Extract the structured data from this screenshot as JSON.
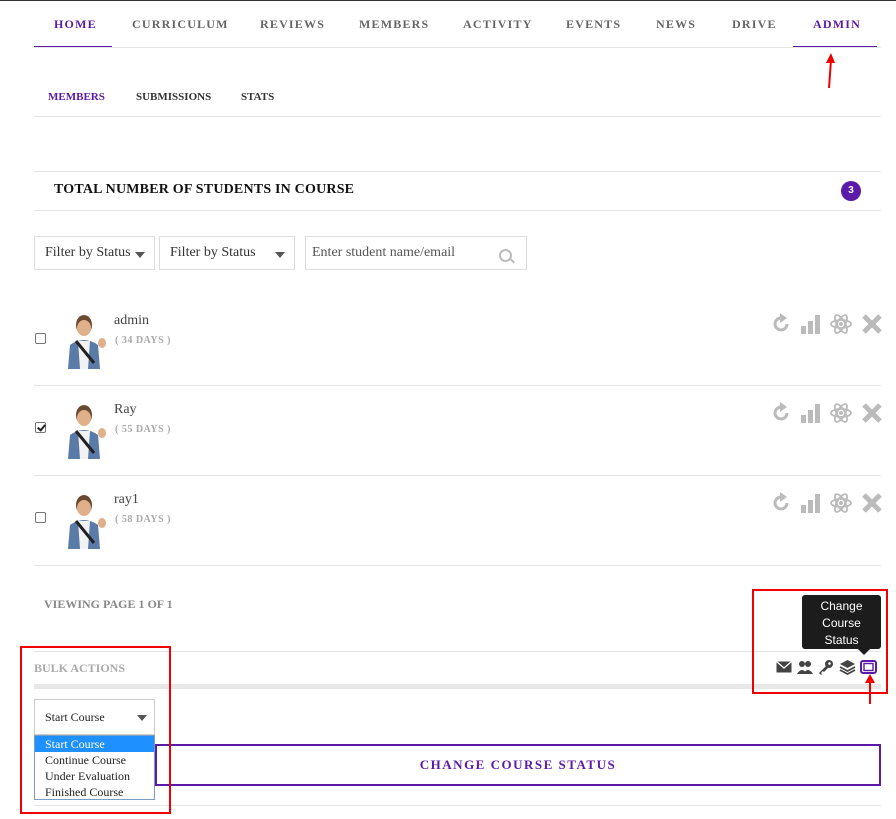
{
  "nav": {
    "items": [
      "HOME",
      "CURRICULUM",
      "REVIEWS",
      "MEMBERS",
      "ACTIVITY",
      "EVENTS",
      "NEWS",
      "DRIVE",
      "ADMIN"
    ]
  },
  "subnav": {
    "items": [
      "MEMBERS",
      "SUBMISSIONS",
      "STATS"
    ]
  },
  "students": {
    "heading": "TOTAL NUMBER OF STUDENTS IN COURSE",
    "count": "3"
  },
  "filters": {
    "status1": "Filter by Status",
    "status2": "Filter by Status",
    "search_placeholder": "Enter student name/email"
  },
  "members": [
    {
      "name": "admin",
      "days": "( 34 DAYS )",
      "checked": false
    },
    {
      "name": "Ray",
      "days": "( 55 DAYS )",
      "checked": true
    },
    {
      "name": "ray1",
      "days": "( 58 DAYS )",
      "checked": false
    }
  ],
  "pagination": {
    "text": "VIEWING PAGE 1 OF 1"
  },
  "bulk": {
    "label": "BULK ACTIONS",
    "tooltip": "Change Course Status",
    "selected": "Start Course",
    "options": [
      "Start Course",
      "Continue Course",
      "Under Evaluation",
      "Finished Course"
    ],
    "button": "CHANGE COURSE STATUS"
  },
  "colors": {
    "accent": "#5b1aa8",
    "annotation": "#f20000"
  }
}
